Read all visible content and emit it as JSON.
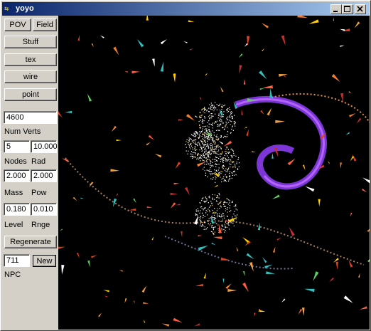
{
  "window": {
    "title": "yoyo",
    "app_icon": "application-icon",
    "controls": [
      "minimize-icon",
      "maximize-icon",
      "close-icon"
    ]
  },
  "sidebar": {
    "pov_label": "POV",
    "field_label": "Field",
    "stuff_label": "Stuff",
    "tex_label": "tex",
    "wire_label": "wire",
    "point_label": "point",
    "num_verts_value": "4600",
    "num_verts_label": "Num Verts",
    "nodes_value": "5",
    "rad_value": "10.000",
    "nodes_label": "Nodes",
    "rad_label": "Rad",
    "mass_value": "2.000",
    "pow_value": "2.000",
    "mass_label": "Mass",
    "pow_label": "Pow",
    "level_value": "0.180",
    "rnge_value": "0.010",
    "level_label": "Level",
    "rnge_label": "Rnge",
    "regenerate_label": "Regenerate",
    "npc_value": "711",
    "new_label": "New",
    "npc_label": "NPC"
  },
  "viewport": {
    "background": "#000000",
    "accent_colors": [
      "#9040ff",
      "#e06020",
      "#ffd000",
      "#30c0c0",
      "#ffffff"
    ]
  }
}
